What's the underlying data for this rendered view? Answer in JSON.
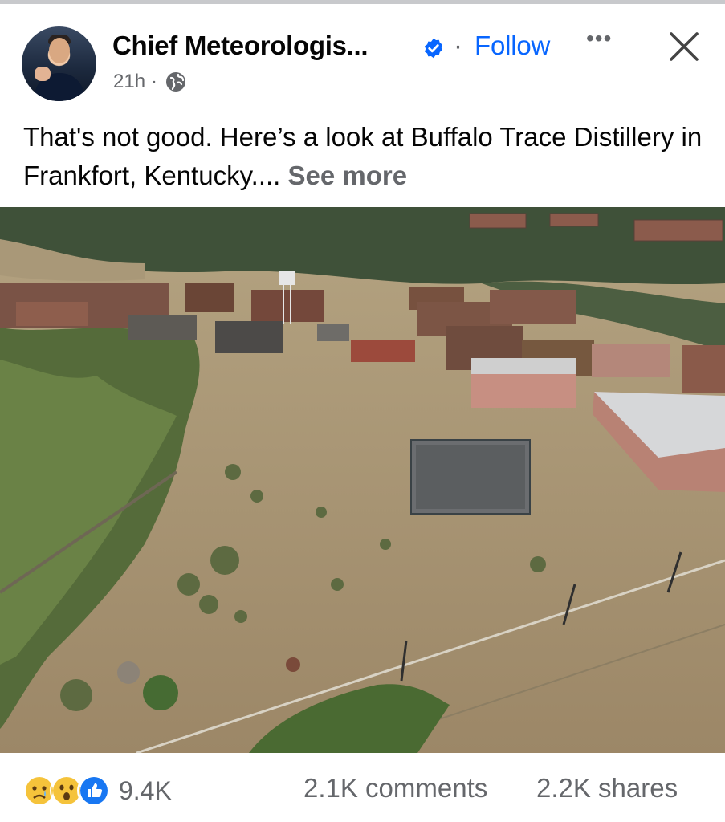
{
  "post": {
    "author": "Chief Meteorologis...",
    "follow_label": "Follow",
    "separator_dot": "·",
    "more_label": "•••",
    "timestamp": "21h",
    "meta_dot": "·",
    "audience_icon": "globe-icon",
    "text_main": "That's not good.  Here’s a look at Buffalo Trace Distillery in Frankfort, Kentucky....",
    "see_more_label": "See more"
  },
  "engagement": {
    "reaction_icons": [
      "sad-reaction-icon",
      "wow-reaction-icon",
      "like-reaction-icon"
    ],
    "reactions_count": "9.4K",
    "comments": "2.1K comments",
    "shares": "2.2K shares"
  },
  "colors": {
    "accent": "#0866ff",
    "secondary_text": "#65676b",
    "verified": "#0866ff",
    "flood_water": "#a58f6e"
  }
}
